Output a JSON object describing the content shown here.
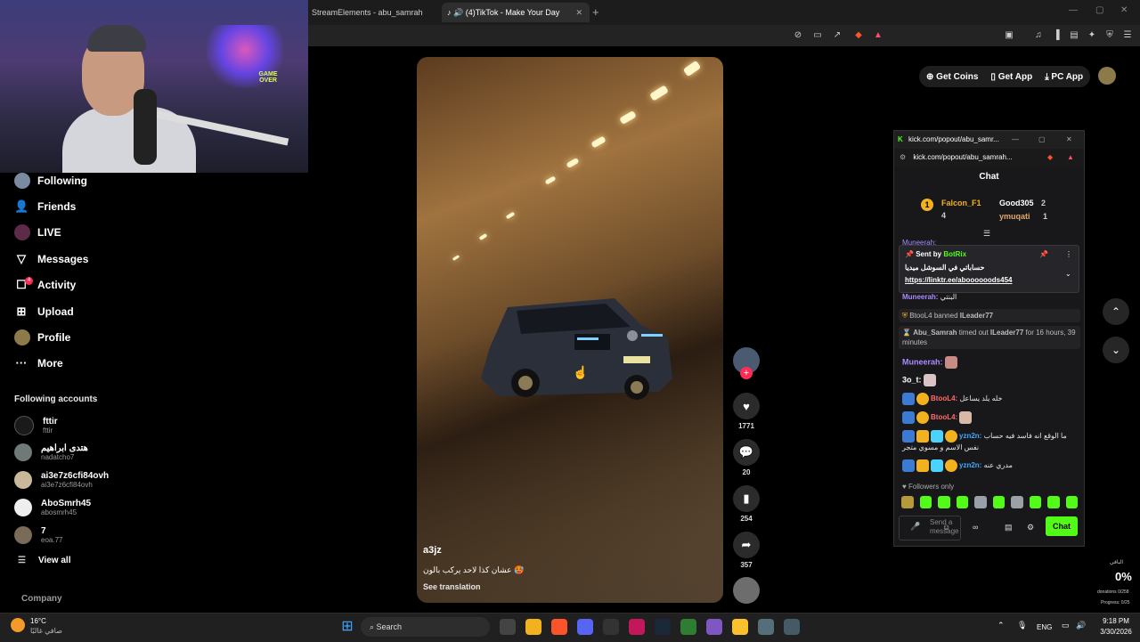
{
  "browser": {
    "tabs": [
      {
        "label": "StreamElements - abu_samrah"
      },
      {
        "label": "(4)TikTok - Make Your Day"
      }
    ],
    "new_tab": "+"
  },
  "webcam": {
    "sign_text": "GAME OVER"
  },
  "sidebar": {
    "items": [
      {
        "label": "Following"
      },
      {
        "label": "Friends"
      },
      {
        "label": "LIVE"
      },
      {
        "label": "Messages"
      },
      {
        "label": "Activity",
        "badge": "4"
      },
      {
        "label": "Upload"
      },
      {
        "label": "Profile"
      },
      {
        "label": "More"
      }
    ],
    "following_header": "Following accounts",
    "accounts": [
      {
        "name": "fttir",
        "handle": "fttir"
      },
      {
        "name": "ﻫﺘﺪﻯ ﺍﺑﺮﺍﻫﻴﻢ",
        "handle": "nadatcho7"
      },
      {
        "name": "ai3e7z6cfi84ovh",
        "handle": "ai3e7z6cfi84ovh"
      },
      {
        "name": "AboSmrh45",
        "handle": "abosmrh45"
      },
      {
        "name": "7",
        "handle": "eoa.77"
      }
    ],
    "view_all": "View all",
    "company": "Company"
  },
  "video": {
    "username": "a3jz",
    "caption": "عشان كذا لاحد يركب بالون 🥵",
    "see_translation": "See translation",
    "plate": "ﻁ ﻉ ﺏ"
  },
  "actions": {
    "likes": "1771",
    "comments": "20",
    "saves": "254",
    "shares": "357"
  },
  "topbar": {
    "get_coins": "Get Coins",
    "get_app": "Get App",
    "pc_app": "PC App"
  },
  "popup": {
    "title": "kick.com/popout/abu_samr...",
    "url": "kick.com/popout/abu_samrah...",
    "chat_title": "Chat",
    "leaderboard": [
      {
        "rank": "1",
        "name": "Falcon_F1",
        "count": "4"
      },
      {
        "rank": "2",
        "name": "Good305",
        "count": "2"
      },
      {
        "rank": "3",
        "name": "ymuqati",
        "count": "1"
      }
    ],
    "pinned": {
      "sent_by": "Sent by",
      "bot": "BotRix",
      "text": "حساباتي في السوشل ميديا",
      "link": "https://linktr.ee/aboooooods454"
    },
    "partial_msg": {
      "user": "Muneerah:",
      "text": "البنتي"
    },
    "events": [
      {
        "user": "BtooL4",
        "action": "banned",
        "target": "ILeader77"
      },
      {
        "user": "Abu_Samrah",
        "action": "timed out",
        "target": "ILeader77",
        "duration": "for 16 hours, 39 minutes"
      }
    ],
    "messages": [
      {
        "user": "Muneerah:",
        "text": ""
      },
      {
        "user": "3o_t:",
        "text": ""
      },
      {
        "user": "BtooL4:",
        "text": "خله يلد يساعل"
      },
      {
        "user": "BtooL4:",
        "text": ""
      },
      {
        "user": "yzn2n:",
        "text": "ما الوقع انه فاسد فيه حساب نفس الاسم و مسوي متجر"
      },
      {
        "user": "yzn2n:",
        "text": "مدري عنه"
      }
    ],
    "followers_only": "Followers only",
    "input_placeholder": "Send a message",
    "chat_button": "Chat"
  },
  "overlay": {
    "label": "الباقي",
    "percent": "0%",
    "donations": "donations 0/258",
    "progress": "Progress: 0/25"
  },
  "taskbar": {
    "weather_temp": "16°C",
    "weather_text": "صافي غالبًا",
    "search": "Search",
    "lang": "ENG",
    "time": "9:18 PM",
    "date": "3/30/2026"
  },
  "colors": {
    "kick_green": "#53fc18",
    "tiktok_red": "#fe2c55"
  }
}
